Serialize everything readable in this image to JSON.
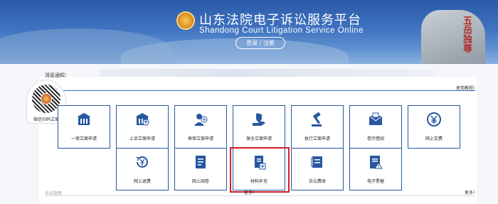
{
  "header": {
    "title": "山东法院电子诉讼服务平台",
    "subtitle": "Shandong Court Litigation Service Online",
    "login_label": "登录 / 注册",
    "rock_text": "五岳独尊"
  },
  "notice": {
    "label": "消息通知："
  },
  "qr": {
    "caption": "微信扫码立案"
  },
  "panel": {
    "help_label": "使用教程〉",
    "tiles_row1": [
      {
        "label": "一审立案申请",
        "icon": "building-document-icon"
      },
      {
        "label": "上诉立案申请",
        "icon": "building-upload-icon"
      },
      {
        "label": "再审立案申请",
        "icon": "person-gavel-icon"
      },
      {
        "label": "保全立案申请",
        "icon": "hand-shield-icon"
      },
      {
        "label": "执行立案申请",
        "icon": "gavel-icon"
      },
      {
        "label": "卷宗借阅",
        "icon": "envelope-icon"
      },
      {
        "label": "网上交费",
        "icon": "yuan-coin-icon"
      }
    ],
    "tiles_row2": [
      {
        "label": "网上退费",
        "icon": "refund-icon"
      },
      {
        "label": "网上阅卷",
        "icon": "document-list-icon"
      },
      {
        "label": "材料补充",
        "icon": "file-add-icon"
      },
      {
        "label": "诉讼费收",
        "icon": "receipt-icon"
      },
      {
        "label": "电子票据",
        "icon": "e-ticket-warning-icon"
      }
    ],
    "bottom_left": "诉讼指南",
    "bottom_mid": "更多〉",
    "bottom_right": "更多〉"
  },
  "colors": {
    "accent": "#27579f",
    "highlight": "#d11e25"
  }
}
